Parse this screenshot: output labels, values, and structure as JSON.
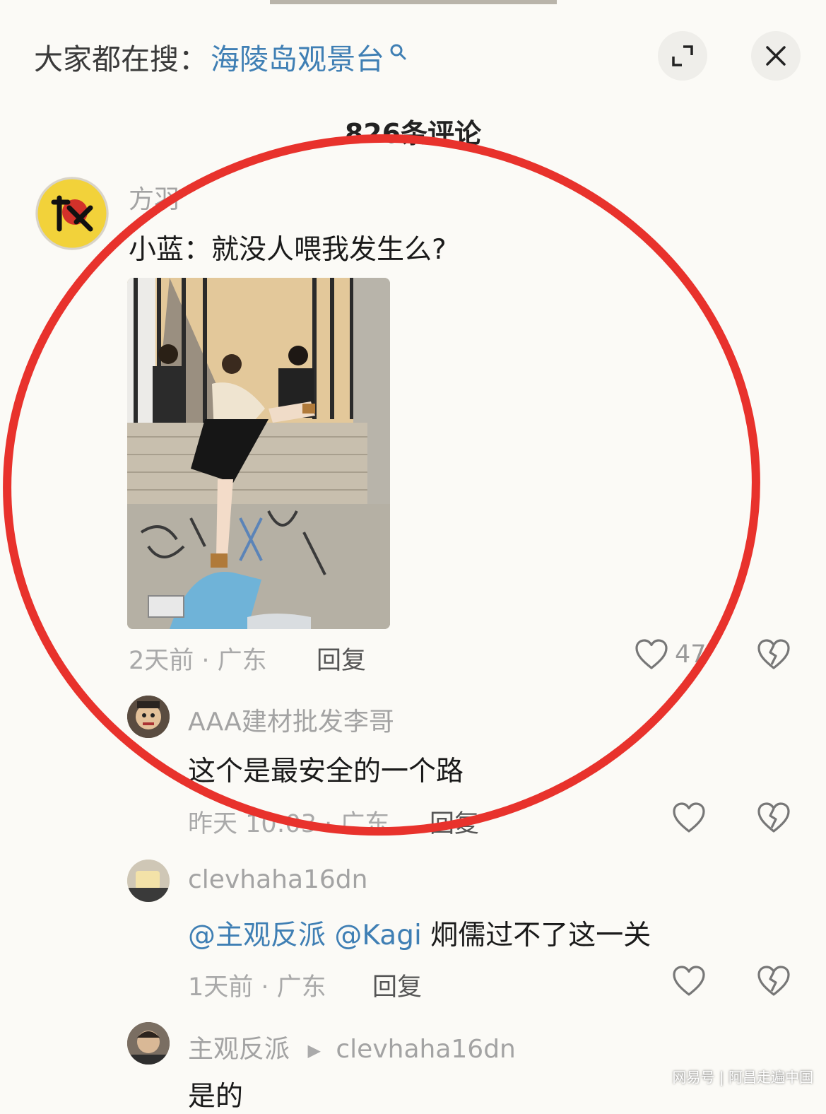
{
  "search": {
    "prefix": "大家都在搜：",
    "query": "海陵岛观景台"
  },
  "header": {
    "comment_count": "826条评论"
  },
  "comments": [
    {
      "username": "方羽",
      "text": "小蓝：就没人喂我发生么?",
      "time_location": "2天前 · 广东",
      "reply_label": "回复",
      "likes": "47"
    },
    {
      "username": "AAA建材批发李哥",
      "text": "这个是最安全的一个路",
      "time_location": "昨天 10:03 · 广东",
      "reply_label": "回复"
    },
    {
      "username": "clevhaha16dn",
      "mentions": [
        "@主观反派",
        "@Kagi"
      ],
      "text": "炯儒过不了这一关",
      "time_location": "1天前 · 广东",
      "reply_label": "回复"
    },
    {
      "username": "主观反派",
      "reply_to": "clevhaha16dn",
      "text": "是的"
    }
  ],
  "colors": {
    "accent": "#3f7fb4",
    "highlight": "#e8322c",
    "background": "#fbfaf6"
  },
  "watermark": "网易号 | 阿昌走遍中国"
}
